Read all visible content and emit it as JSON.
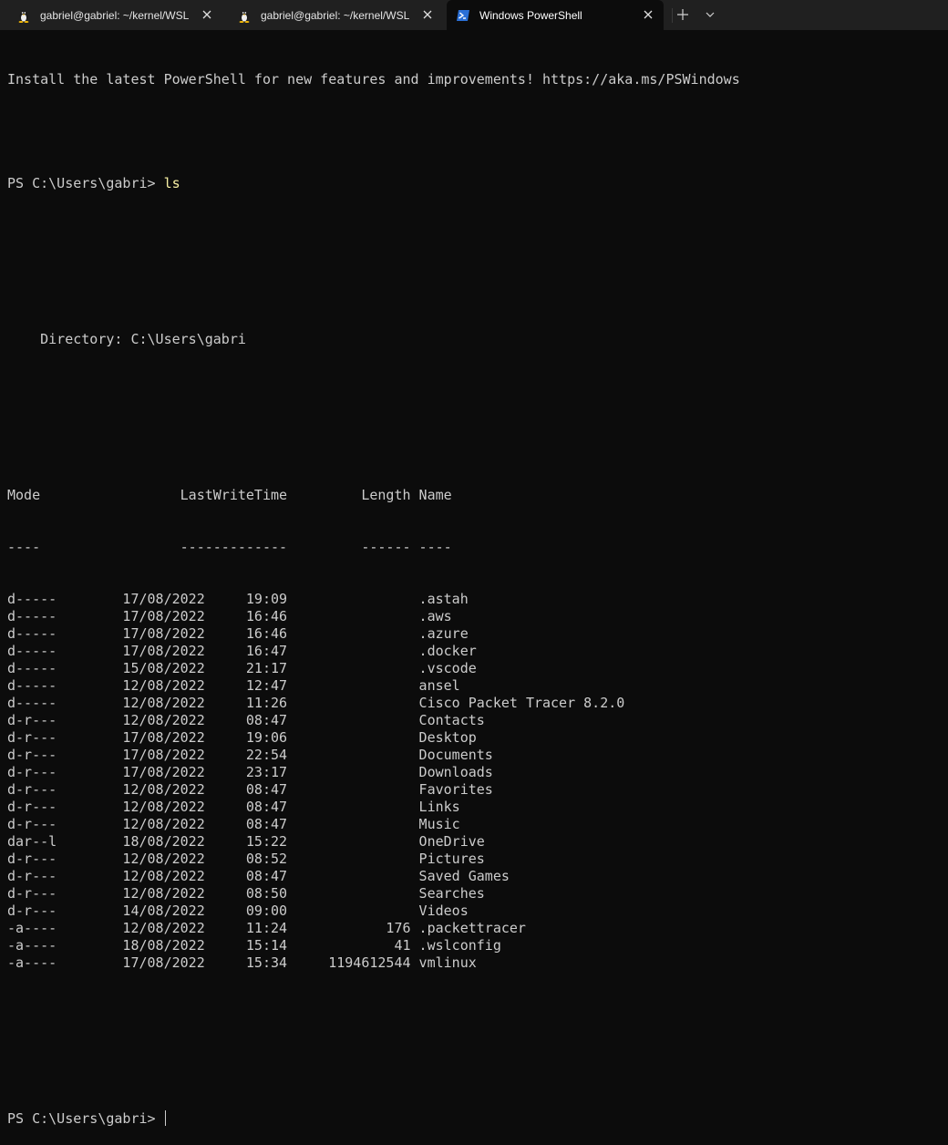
{
  "tabs": [
    {
      "label": "gabriel@gabriel: ~/kernel/WSL",
      "icon": "linux-penguin-icon",
      "active": false
    },
    {
      "label": "gabriel@gabriel: ~/kernel/WSL",
      "icon": "linux-penguin-icon",
      "active": false
    },
    {
      "label": "Windows PowerShell",
      "icon": "powershell-icon",
      "active": true
    }
  ],
  "tabbar": {
    "new_tab_icon": "plus-icon",
    "dropdown_icon": "chevron-down-icon"
  },
  "terminal": {
    "banner": "Install the latest PowerShell for new features and improvements! https://aka.ms/PSWindows",
    "prompt": "PS C:\\Users\\gabri> ",
    "command": "ls",
    "directory_line": "    Directory: C:\\Users\\gabri",
    "header": "Mode                 LastWriteTime         Length Name",
    "header_rule": "----                 -------------         ------ ----",
    "rows": [
      {
        "mode": "d-----",
        "date": "17/08/2022",
        "time": "19:09",
        "length": "",
        "name": ".astah"
      },
      {
        "mode": "d-----",
        "date": "17/08/2022",
        "time": "16:46",
        "length": "",
        "name": ".aws"
      },
      {
        "mode": "d-----",
        "date": "17/08/2022",
        "time": "16:46",
        "length": "",
        "name": ".azure"
      },
      {
        "mode": "d-----",
        "date": "17/08/2022",
        "time": "16:47",
        "length": "",
        "name": ".docker"
      },
      {
        "mode": "d-----",
        "date": "15/08/2022",
        "time": "21:17",
        "length": "",
        "name": ".vscode"
      },
      {
        "mode": "d-----",
        "date": "12/08/2022",
        "time": "12:47",
        "length": "",
        "name": "ansel"
      },
      {
        "mode": "d-----",
        "date": "12/08/2022",
        "time": "11:26",
        "length": "",
        "name": "Cisco Packet Tracer 8.2.0"
      },
      {
        "mode": "d-r---",
        "date": "12/08/2022",
        "time": "08:47",
        "length": "",
        "name": "Contacts"
      },
      {
        "mode": "d-r---",
        "date": "17/08/2022",
        "time": "19:06",
        "length": "",
        "name": "Desktop"
      },
      {
        "mode": "d-r---",
        "date": "17/08/2022",
        "time": "22:54",
        "length": "",
        "name": "Documents"
      },
      {
        "mode": "d-r---",
        "date": "17/08/2022",
        "time": "23:17",
        "length": "",
        "name": "Downloads"
      },
      {
        "mode": "d-r---",
        "date": "12/08/2022",
        "time": "08:47",
        "length": "",
        "name": "Favorites"
      },
      {
        "mode": "d-r---",
        "date": "12/08/2022",
        "time": "08:47",
        "length": "",
        "name": "Links"
      },
      {
        "mode": "d-r---",
        "date": "12/08/2022",
        "time": "08:47",
        "length": "",
        "name": "Music"
      },
      {
        "mode": "dar--l",
        "date": "18/08/2022",
        "time": "15:22",
        "length": "",
        "name": "OneDrive"
      },
      {
        "mode": "d-r---",
        "date": "12/08/2022",
        "time": "08:52",
        "length": "",
        "name": "Pictures"
      },
      {
        "mode": "d-r---",
        "date": "12/08/2022",
        "time": "08:47",
        "length": "",
        "name": "Saved Games"
      },
      {
        "mode": "d-r---",
        "date": "12/08/2022",
        "time": "08:50",
        "length": "",
        "name": "Searches"
      },
      {
        "mode": "d-r---",
        "date": "14/08/2022",
        "time": "09:00",
        "length": "",
        "name": "Videos"
      },
      {
        "mode": "-a----",
        "date": "12/08/2022",
        "time": "11:24",
        "length": "176",
        "name": ".packettracer"
      },
      {
        "mode": "-a----",
        "date": "18/08/2022",
        "time": "15:14",
        "length": "41",
        "name": ".wslconfig"
      },
      {
        "mode": "-a----",
        "date": "17/08/2022",
        "time": "15:34",
        "length": "1194612544",
        "name": "vmlinux"
      }
    ],
    "colors": {
      "background": "#0c0c0c",
      "foreground": "#cccccc",
      "command": "#f9f1a5",
      "tabbar": "#202020"
    }
  }
}
